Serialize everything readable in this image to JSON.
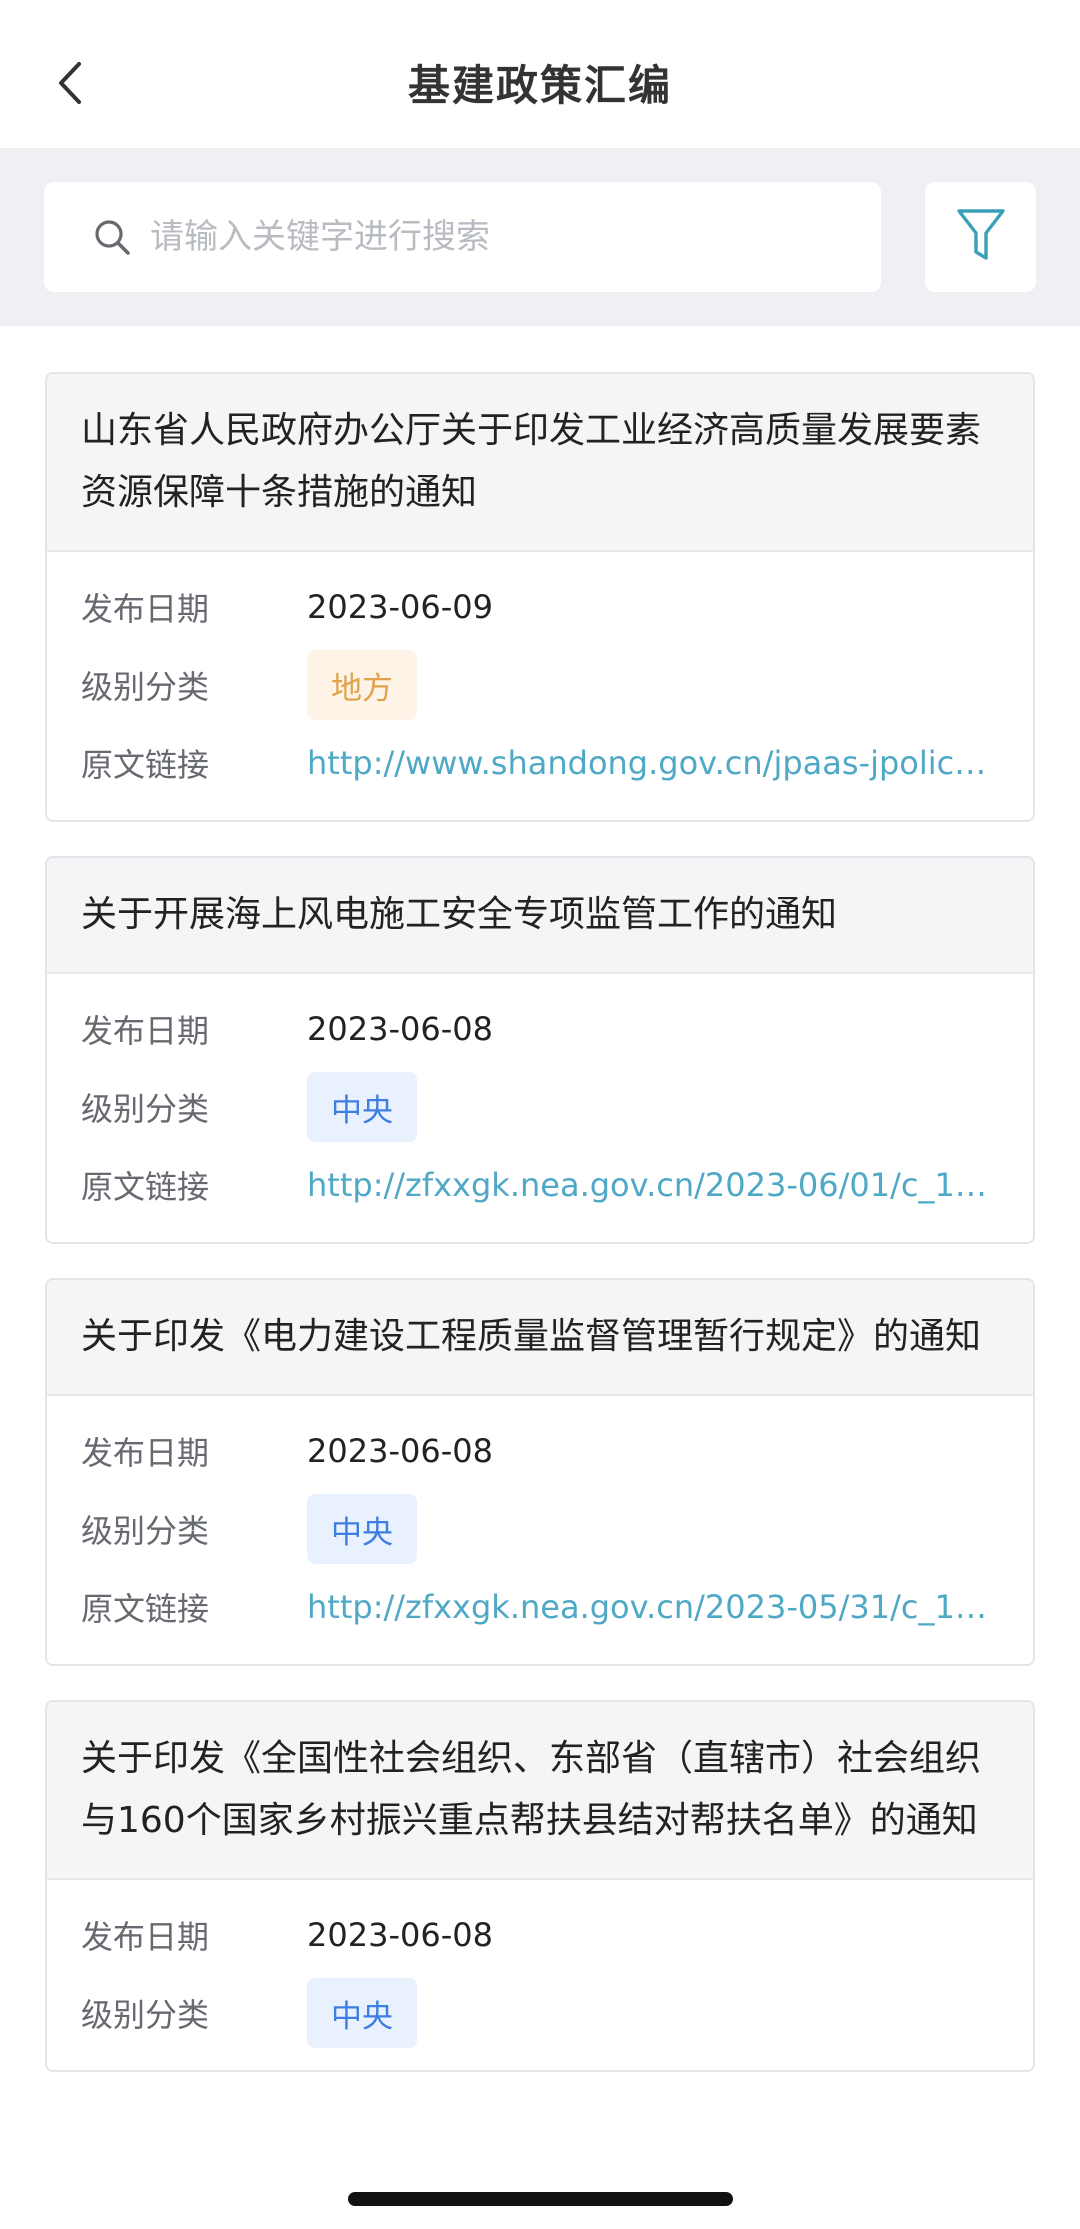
{
  "header": {
    "title": "基建政策汇编",
    "back_icon": "chevron-left-icon"
  },
  "search": {
    "placeholder": "请输入关键字进行搜索",
    "value": "",
    "icon": "search-icon",
    "filter_icon": "filter-funnel-icon"
  },
  "labels": {
    "date": "发布日期",
    "level": "级别分类",
    "link": "原文链接"
  },
  "colors": {
    "link": "#4fa8c5",
    "tag_local": "#e0a24a",
    "tag_central": "#3d7fe0",
    "background_band": "#eef0f3"
  },
  "policies": [
    {
      "title": "山东省人民政府办公厅关于印发工业经济高质量发展要素资源保障十条措施的通知",
      "date": "2023-06-09",
      "level": "地方",
      "link": "http://www.shandong.gov.cn/jpaas-jpolicy-w..."
    },
    {
      "title": "关于开展海上风电施工安全专项监管工作的通知",
      "date": "2023-06-08",
      "level": "中央",
      "link": "http://zfxxgk.nea.gov.cn/2023-06/01/c_131..."
    },
    {
      "title": "关于印发《电力建设工程质量监督管理暂行规定》的通知",
      "date": "2023-06-08",
      "level": "中央",
      "link": "http://zfxxgk.nea.gov.cn/2023-05/31/c_131..."
    },
    {
      "title": "关于印发《全国性社会组织、东部省（直辖市）社会组织与160个国家乡村振兴重点帮扶县结对帮扶名单》的通知",
      "date": "2023-06-08",
      "level": "中央",
      "link": ""
    }
  ]
}
